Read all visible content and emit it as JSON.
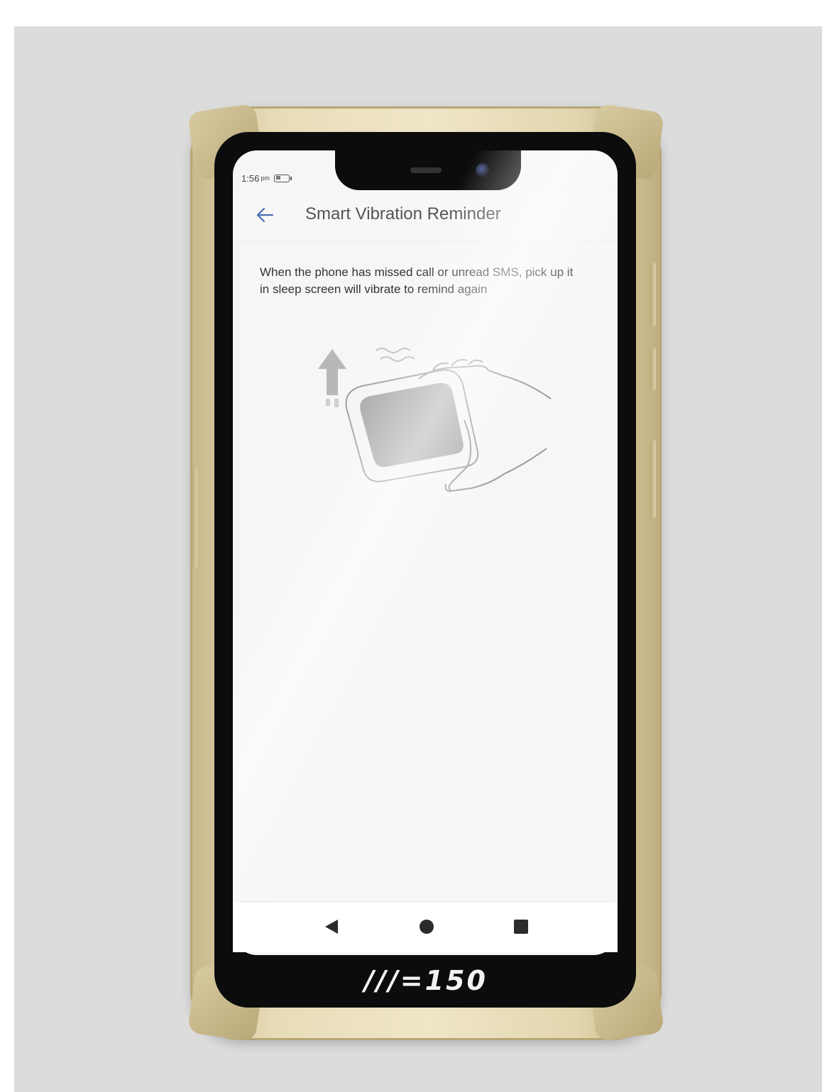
{
  "status_bar": {
    "time": "1:56",
    "meridiem": "pm"
  },
  "header": {
    "back_icon": "arrow-left-icon",
    "title": "Smart Vibration Reminder"
  },
  "content": {
    "description": "When the phone has missed call or unread SMS, pick up it in sleep screen will vibrate to remind again",
    "illustration": "hand-lifting-phone-vibrate-illustration"
  },
  "nav_bar": {
    "back_icon": "triangle-back-icon",
    "home_icon": "circle-home-icon",
    "recents_icon": "square-recents-icon"
  },
  "device": {
    "brand": "///=150"
  },
  "colors": {
    "accent": "#4a6fb3",
    "frame": "#e8dcb8",
    "screen_bg": "#f6f6f6"
  }
}
